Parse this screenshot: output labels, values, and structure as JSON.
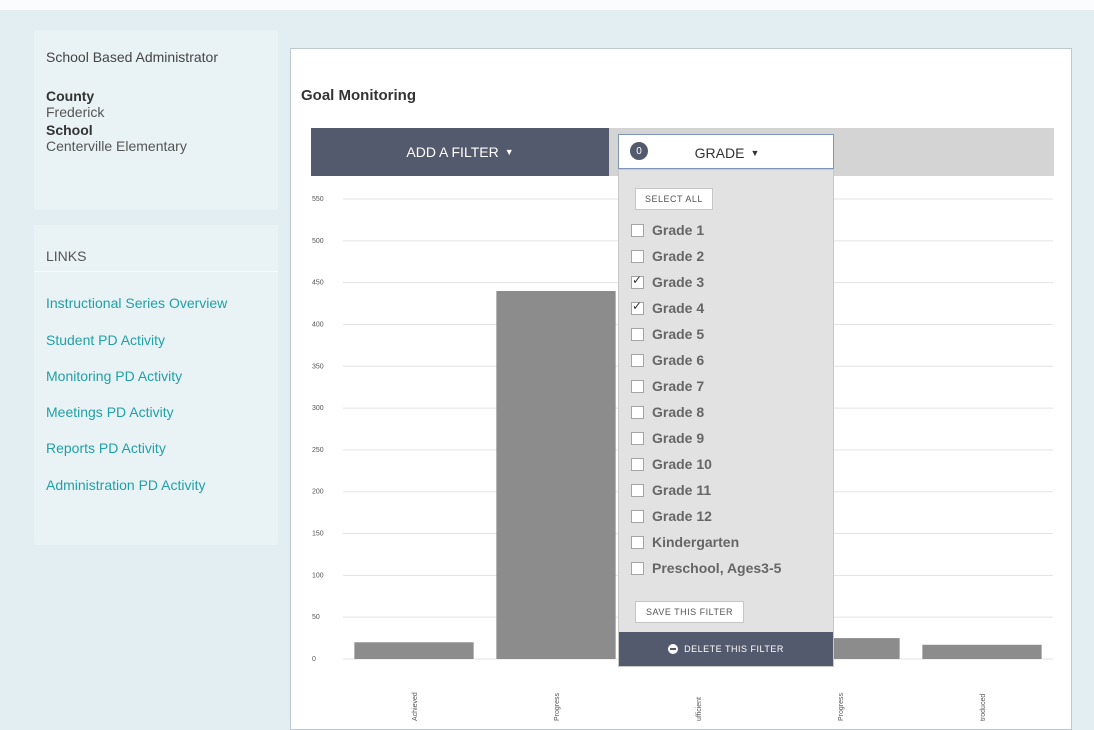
{
  "profile": {
    "role": "School Based Administrator",
    "county_label": "County",
    "county_value": "Frederick",
    "school_label": "School",
    "school_value": "Centerville Elementary"
  },
  "links": {
    "title": "LINKS",
    "items": [
      {
        "label": "Instructional Series Overview"
      },
      {
        "label": "Student PD Activity"
      },
      {
        "label": "Monitoring PD Activity"
      },
      {
        "label": "Meetings PD Activity"
      },
      {
        "label": "Reports PD Activity"
      },
      {
        "label": "Administration PD Activity"
      }
    ]
  },
  "main": {
    "title": "Goal Monitoring",
    "add_filter_label": "ADD A FILTER",
    "grade_filter": {
      "count": "0",
      "label": "GRADE"
    }
  },
  "dropdown": {
    "select_all": "SELECT ALL",
    "options": [
      {
        "label": "Grade 1",
        "checked": false
      },
      {
        "label": "Grade 2",
        "checked": false
      },
      {
        "label": "Grade 3",
        "checked": true
      },
      {
        "label": "Grade 4",
        "checked": true
      },
      {
        "label": "Grade 5",
        "checked": false
      },
      {
        "label": "Grade 6",
        "checked": false
      },
      {
        "label": "Grade 7",
        "checked": false
      },
      {
        "label": "Grade 8",
        "checked": false
      },
      {
        "label": "Grade 9",
        "checked": false
      },
      {
        "label": "Grade 10",
        "checked": false
      },
      {
        "label": "Grade 11",
        "checked": false
      },
      {
        "label": "Grade 12",
        "checked": false
      },
      {
        "label": "Kindergarten",
        "checked": false
      },
      {
        "label": "Preschool, Ages3-5",
        "checked": false
      }
    ],
    "save": "SAVE THIS FILTER",
    "delete": "DELETE THIS FILTER"
  },
  "chart_data": {
    "type": "bar",
    "categories": [
      "Achieved",
      "Progress",
      "ufficient",
      "Progress",
      "troduced"
    ],
    "values": [
      20,
      440,
      null,
      25,
      17
    ],
    "ylim": [
      0,
      550
    ],
    "yticks": [
      0,
      50,
      100,
      150,
      200,
      250,
      300,
      350,
      400,
      450,
      500,
      550
    ],
    "grid": true,
    "bar_color": "#8c8c8c"
  }
}
